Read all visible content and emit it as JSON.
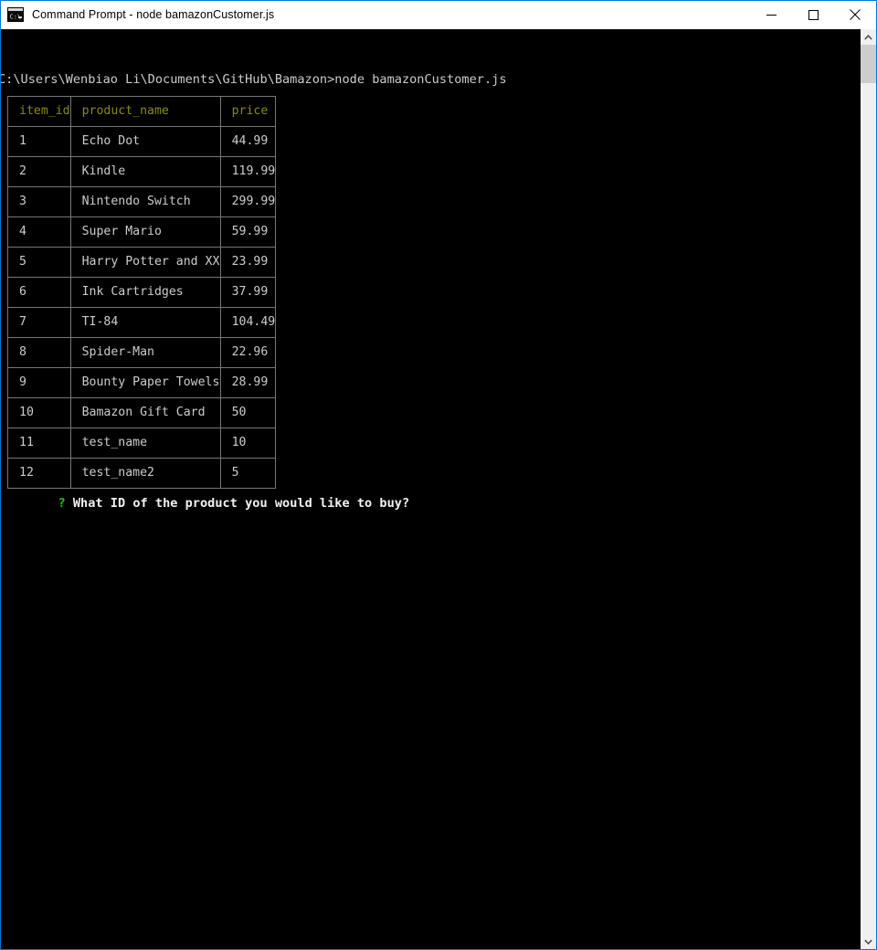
{
  "window": {
    "title": "Command Prompt - node  bamazonCustomer.js",
    "icon": "cmd-console-icon",
    "accent_color": "#0078d7",
    "controls": {
      "minimize": "minimize-icon",
      "maximize": "maximize-icon",
      "close": "close-icon"
    }
  },
  "console": {
    "command_line": "C:\\Users\\Wenbiao Li\\Documents\\GitHub\\Bamazon>node bamazonCustomer.js",
    "prompt": {
      "marker": "?",
      "marker_color": "#16c60c",
      "question": "What ID of the product you would like to buy?"
    },
    "header_color": "#8a8a15",
    "text_color": "#cccccc",
    "background": "#000000"
  },
  "table": {
    "columns": [
      "item_id",
      "product_name",
      "price"
    ],
    "rows": [
      [
        "1",
        "Echo Dot",
        "44.99"
      ],
      [
        "2",
        "Kindle",
        "119.99"
      ],
      [
        "3",
        "Nintendo Switch",
        "299.99"
      ],
      [
        "4",
        "Super Mario",
        "59.99"
      ],
      [
        "5",
        "Harry Potter and XX",
        "23.99"
      ],
      [
        "6",
        "Ink Cartridges",
        "37.99"
      ],
      [
        "7",
        "TI-84",
        "104.49"
      ],
      [
        "8",
        "Spider-Man",
        "22.96"
      ],
      [
        "9",
        "Bounty Paper Towels",
        "28.99"
      ],
      [
        "10",
        "Bamazon Gift Card",
        "50"
      ],
      [
        "11",
        "test_name",
        "10"
      ],
      [
        "12",
        "test_name2",
        "5"
      ]
    ]
  },
  "scrollbar": {
    "up_arrow": "chevron-up-icon",
    "down_arrow": "chevron-down-icon"
  }
}
